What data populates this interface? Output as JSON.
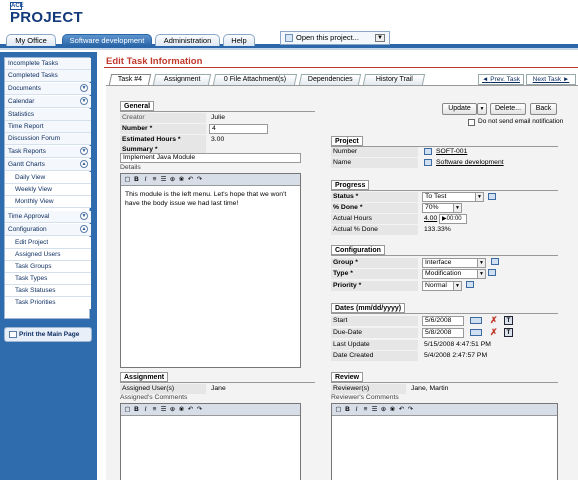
{
  "header": {
    "logo_small": "ACE",
    "logo_text": "PROJECT",
    "tabs": [
      "My Office",
      "Software development",
      "Administration",
      "Help"
    ],
    "open_project": "Open this project..."
  },
  "sidebar": {
    "items": [
      "Incomplete Tasks",
      "Completed Tasks",
      "Documents",
      "Calendar",
      "Statistics",
      "Time Report",
      "Discussion Forum",
      "Task Reports",
      "Gantt Charts",
      "Daily View",
      "Weekly View",
      "Monthly View",
      "Time Approval",
      "Configuration",
      "Edit Project",
      "Assigned Users",
      "Task Groups",
      "Task Types",
      "Task Statuses",
      "Task Priorities"
    ],
    "print_label": "Print the Main Page"
  },
  "page_title": "Edit Task Information",
  "subtabs": [
    "Task #4",
    "Assignment",
    "0 File Attachment(s)",
    "Dependencies",
    "History Trail"
  ],
  "nav": {
    "prev": "Prev. Task",
    "next": "Next Task"
  },
  "buttons": {
    "update": "Update",
    "delete": "Delete...",
    "back": "Back",
    "no_email": "Do not send email notification"
  },
  "general": {
    "title": "General",
    "creator_label": "Creator",
    "creator": "Julie",
    "number_label": "Number *",
    "number": "4",
    "estimated_label": "Estimated Hours *",
    "estimated": "3.00",
    "summary_label": "Summary *",
    "summary": "Implement Java Module",
    "details_label": "Details",
    "details_text": "This module is the left menu. Let's hope that we won't have the body issue we had last time!"
  },
  "project": {
    "title": "Project",
    "number_label": "Number",
    "number": "SOFT-001",
    "name_label": "Name",
    "name": "Software development"
  },
  "progress": {
    "title": "Progress",
    "status_label": "Status *",
    "status": "To Test",
    "done_label": "% Done *",
    "done": "70%",
    "hours_label": "Actual Hours",
    "hours": "4.00",
    "hours_timer": "00:00",
    "actual_done_label": "Actual % Done",
    "actual_done": "133.33%"
  },
  "configuration": {
    "title": "Configuration",
    "group_label": "Group *",
    "group": "Interface",
    "type_label": "Type *",
    "type": "Modification",
    "priority_label": "Priority *",
    "priority": "Normal"
  },
  "dates": {
    "title": "Dates (mm/dd/yyyy)",
    "start_label": "Start",
    "start": "5/6/2008",
    "due_label": "Due-Date",
    "due": "5/8/2008",
    "last_update_label": "Last Update",
    "last_update": "5/15/2008 4:47:51 PM",
    "created_label": "Date Created",
    "created": "5/4/2008 2:47:57 PM"
  },
  "assignment": {
    "title": "Assignment",
    "users_label": "Assigned User(s)",
    "users": "Jane",
    "comments_label": "Assigned's Comments"
  },
  "review": {
    "title": "Review",
    "reviewers_label": "Reviewer(s)",
    "reviewers": "Jane, Martin",
    "comments_label": "Reviewer's Comments"
  }
}
